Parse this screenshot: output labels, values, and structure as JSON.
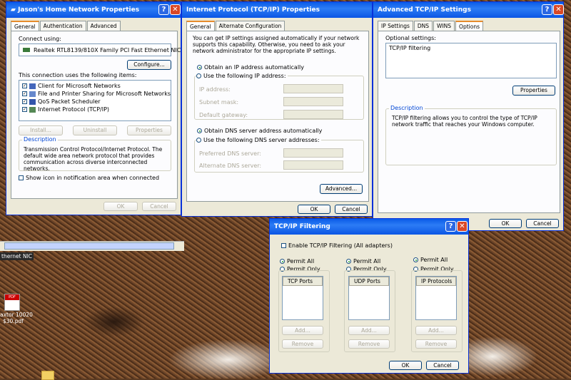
{
  "win1": {
    "title": "Jason's Home Network Properties",
    "tabs": [
      "General",
      "Authentication",
      "Advanced"
    ],
    "connect_using_label": "Connect using:",
    "adapter": "Realtek RTL8139/810X Family PCI Fast Ethernet NIC",
    "configure": "Configure...",
    "items_label": "This connection uses the following items:",
    "items": [
      "Client for Microsoft Networks",
      "File and Printer Sharing for Microsoft Networks",
      "QoS Packet Scheduler",
      "Internet Protocol (TCP/IP)"
    ],
    "install": "Install...",
    "uninstall": "Uninstall",
    "properties": "Properties",
    "description_label": "Description",
    "description": "Transmission Control Protocol/Internet Protocol. The default wide area network protocol that provides communication across diverse interconnected networks.",
    "show_icon": "Show icon in notification area when connected",
    "ok": "OK",
    "cancel": "Cancel",
    "status_fragment": "thernet NIC"
  },
  "win2": {
    "title": "Internet Protocol (TCP/IP) Properties",
    "tabs": [
      "General",
      "Alternate Configuration"
    ],
    "intro": "You can get IP settings assigned automatically if your network supports this capability. Otherwise, you need to ask your network administrator for the appropriate IP settings.",
    "auto_ip": "Obtain an IP address automatically",
    "use_ip": "Use the following IP address:",
    "ip_label": "IP address:",
    "mask_label": "Subnet mask:",
    "gateway_label": "Default gateway:",
    "auto_dns": "Obtain DNS server address automatically",
    "use_dns": "Use the following DNS server addresses:",
    "pref_dns": "Preferred DNS server:",
    "alt_dns": "Alternate DNS server:",
    "advanced": "Advanced...",
    "ok": "OK",
    "cancel": "Cancel"
  },
  "win3": {
    "title": "Advanced TCP/IP Settings",
    "tabs": [
      "IP Settings",
      "DNS",
      "WINS",
      "Options"
    ],
    "optional_label": "Optional settings:",
    "option_item": "TCP/IP filtering",
    "properties": "Properties",
    "description_label": "Description",
    "description": "TCP/IP filtering allows you to control the type of TCP/IP network traffic that reaches your Windows computer.",
    "ok": "OK",
    "cancel": "Cancel"
  },
  "win4": {
    "title": "TCP/IP Filtering",
    "enable": "Enable TCP/IP Filtering (All adapters)",
    "permit_all": "Permit All",
    "permit_only": "Permit Only",
    "tcp_ports": "TCP Ports",
    "udp_ports": "UDP Ports",
    "ip_protocols": "IP Protocols",
    "add": "Add...",
    "remove": "Remove",
    "ok": "OK",
    "cancel": "Cancel"
  },
  "desktop": {
    "icon_label_1": "axtor 10020",
    "icon_label_2": "$30.pdf"
  },
  "colors": {
    "titlebar": "#0a5be7",
    "dialog_bg": "#ece9d8",
    "close": "#d94827"
  }
}
